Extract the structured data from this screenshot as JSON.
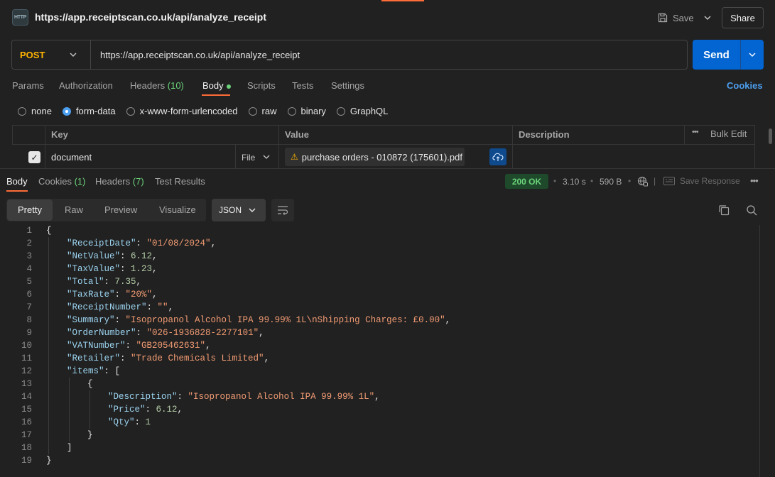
{
  "header": {
    "icon_text": "HTTP",
    "title": "https://app.receiptscan.co.uk/api/analyze_receipt",
    "save_label": "Save",
    "share_label": "Share"
  },
  "request": {
    "method": "POST",
    "url": "https://app.receiptscan.co.uk/api/analyze_receipt",
    "send_label": "Send"
  },
  "request_tabs": {
    "params": "Params",
    "authorization": "Authorization",
    "headers": "Headers",
    "headers_count": "(10)",
    "body": "Body",
    "scripts": "Scripts",
    "tests": "Tests",
    "settings": "Settings",
    "cookies": "Cookies"
  },
  "body_types": {
    "none": "none",
    "form_data": "form-data",
    "urlencoded": "x-www-form-urlencoded",
    "raw": "raw",
    "binary": "binary",
    "graphql": "GraphQL",
    "selected": "form-data"
  },
  "form_table": {
    "headers": {
      "key": "Key",
      "value": "Value",
      "description": "Description",
      "bulk_edit": "Bulk Edit"
    },
    "rows": [
      {
        "key": "document",
        "type": "File",
        "value": "purchase orders - 010872 (175601).pdf",
        "description": ""
      }
    ]
  },
  "response_tabs": {
    "body": "Body",
    "cookies": "Cookies",
    "cookies_count": "(1)",
    "headers": "Headers",
    "headers_count": "(7)",
    "test_results": "Test Results"
  },
  "response_meta": {
    "status": "200 OK",
    "time": "3.10 s",
    "size": "590 B",
    "save_response": "Save Response"
  },
  "view_modes": {
    "pretty": "Pretty",
    "raw": "Raw",
    "preview": "Preview",
    "visualize": "Visualize",
    "format": "JSON"
  },
  "code_lines": [
    {
      "n": "1",
      "indent": 0,
      "parts": [
        [
          "p",
          "{"
        ]
      ]
    },
    {
      "n": "2",
      "indent": 1,
      "parts": [
        [
          "k",
          "\"ReceiptDate\""
        ],
        [
          "p",
          ": "
        ],
        [
          "s",
          "\"01/08/2024\""
        ],
        [
          "p",
          ","
        ]
      ]
    },
    {
      "n": "3",
      "indent": 1,
      "parts": [
        [
          "k",
          "\"NetValue\""
        ],
        [
          "p",
          ": "
        ],
        [
          "n",
          "6.12"
        ],
        [
          "p",
          ","
        ]
      ]
    },
    {
      "n": "4",
      "indent": 1,
      "parts": [
        [
          "k",
          "\"TaxValue\""
        ],
        [
          "p",
          ": "
        ],
        [
          "n",
          "1.23"
        ],
        [
          "p",
          ","
        ]
      ]
    },
    {
      "n": "5",
      "indent": 1,
      "parts": [
        [
          "k",
          "\"Total\""
        ],
        [
          "p",
          ": "
        ],
        [
          "n",
          "7.35"
        ],
        [
          "p",
          ","
        ]
      ]
    },
    {
      "n": "6",
      "indent": 1,
      "parts": [
        [
          "k",
          "\"TaxRate\""
        ],
        [
          "p",
          ": "
        ],
        [
          "s",
          "\"20%\""
        ],
        [
          "p",
          ","
        ]
      ]
    },
    {
      "n": "7",
      "indent": 1,
      "parts": [
        [
          "k",
          "\"ReceiptNumber\""
        ],
        [
          "p",
          ": "
        ],
        [
          "s",
          "\"\""
        ],
        [
          "p",
          ","
        ]
      ]
    },
    {
      "n": "8",
      "indent": 1,
      "parts": [
        [
          "k",
          "\"Summary\""
        ],
        [
          "p",
          ": "
        ],
        [
          "s",
          "\"Isopropanol Alcohol IPA 99.99% 1L\\nShipping Charges: £0.00\""
        ],
        [
          "p",
          ","
        ]
      ]
    },
    {
      "n": "9",
      "indent": 1,
      "parts": [
        [
          "k",
          "\"OrderNumber\""
        ],
        [
          "p",
          ": "
        ],
        [
          "s",
          "\"026-1936828-2277101\""
        ],
        [
          "p",
          ","
        ]
      ]
    },
    {
      "n": "10",
      "indent": 1,
      "parts": [
        [
          "k",
          "\"VATNumber\""
        ],
        [
          "p",
          ": "
        ],
        [
          "s",
          "\"GB205462631\""
        ],
        [
          "p",
          ","
        ]
      ]
    },
    {
      "n": "11",
      "indent": 1,
      "parts": [
        [
          "k",
          "\"Retailer\""
        ],
        [
          "p",
          ": "
        ],
        [
          "s",
          "\"Trade Chemicals Limited\""
        ],
        [
          "p",
          ","
        ]
      ]
    },
    {
      "n": "12",
      "indent": 1,
      "parts": [
        [
          "k",
          "\"items\""
        ],
        [
          "p",
          ": ["
        ]
      ]
    },
    {
      "n": "13",
      "indent": 2,
      "parts": [
        [
          "p",
          "{"
        ]
      ]
    },
    {
      "n": "14",
      "indent": 3,
      "parts": [
        [
          "k",
          "\"Description\""
        ],
        [
          "p",
          ": "
        ],
        [
          "s",
          "\"Isopropanol Alcohol IPA 99.99% 1L\""
        ],
        [
          "p",
          ","
        ]
      ]
    },
    {
      "n": "15",
      "indent": 3,
      "parts": [
        [
          "k",
          "\"Price\""
        ],
        [
          "p",
          ": "
        ],
        [
          "n",
          "6.12"
        ],
        [
          "p",
          ","
        ]
      ]
    },
    {
      "n": "16",
      "indent": 3,
      "parts": [
        [
          "k",
          "\"Qty\""
        ],
        [
          "p",
          ": "
        ],
        [
          "n",
          "1"
        ]
      ]
    },
    {
      "n": "17",
      "indent": 2,
      "parts": [
        [
          "p",
          "}"
        ]
      ]
    },
    {
      "n": "18",
      "indent": 1,
      "parts": [
        [
          "p",
          "]"
        ]
      ]
    },
    {
      "n": "19",
      "indent": 0,
      "parts": [
        [
          "p",
          "}"
        ]
      ]
    }
  ],
  "colors": {
    "accent": "#ff6c37",
    "send": "#0265d2",
    "method": "#ffb400",
    "status_ok": "#6bd37a",
    "json_key": "#9cd4f0",
    "json_string": "#f29b73",
    "json_number": "#b5cea8"
  }
}
